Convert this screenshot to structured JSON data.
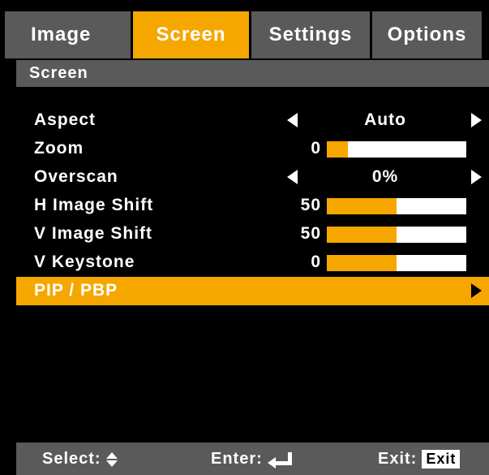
{
  "tabs": [
    {
      "label": "Image",
      "active": false
    },
    {
      "label": "Screen",
      "active": true
    },
    {
      "label": "Settings",
      "active": false
    },
    {
      "label": "Options",
      "active": false
    }
  ],
  "section_title": "Screen",
  "menu": {
    "aspect": {
      "label": "Aspect",
      "value": "Auto"
    },
    "zoom": {
      "label": "Zoom",
      "value": "0",
      "level": 0.15
    },
    "overscan": {
      "label": "Overscan",
      "value": "0%"
    },
    "h_image_shift": {
      "label": "H Image Shift",
      "value": "50",
      "level": 0.5
    },
    "v_image_shift": {
      "label": "V Image Shift",
      "value": "50",
      "level": 0.5
    },
    "v_keystone": {
      "label": "V Keystone",
      "value": "0",
      "level": 0.5
    },
    "pip_pbp": {
      "label": "PIP / PBP",
      "selected": true
    }
  },
  "footer": {
    "select_label": "Select:",
    "enter_label": "Enter:",
    "exit_label": "Exit:",
    "exit_key": "Exit"
  },
  "colors": {
    "accent": "#f5a700",
    "bar_track": "#ffffff",
    "panel": "#5a5a5a",
    "background": "#000000"
  },
  "icons": {
    "left_arrow": "triangle-left-icon",
    "right_arrow": "triangle-right-icon",
    "select": "up-down-icon",
    "enter": "enter-return-icon"
  }
}
